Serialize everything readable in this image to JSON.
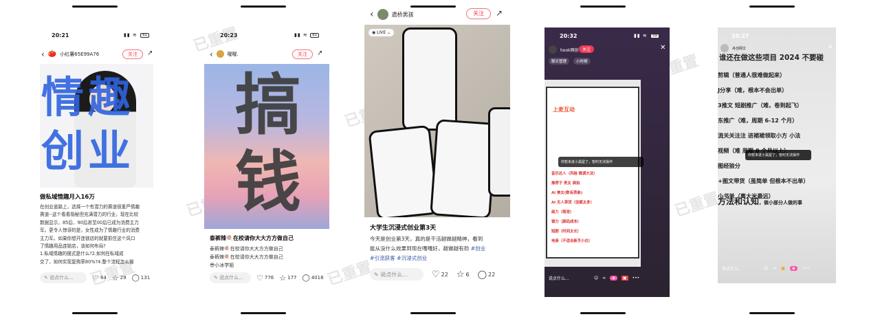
{
  "watermark": "已重置",
  "p1": {
    "time": "20:21",
    "battery": "61",
    "user": "小红薯65E99A76",
    "follow": "关注",
    "art_text": "情趣创业",
    "title": "做私域情趣月入16万",
    "lines": [
      "在创业道路上，选择一个有潜力的赛道很重严情趣",
      "赛道--这个看看隐秘但充满潜力的行业，现在比较",
      "数据显示，85后、90后甚至00后已成为消费主力",
      "军。更令人惊讶的是，女性成为了情趣行业的消费",
      "主力军。如果你想开连锁店的就要抓住这个风口",
      "了情趣用品连锁店，该如何布局?",
      "1.私域情趣的模式是什么?2.如何在私域成",
      "交了，如何实现复购率80%?4.整个流程怎么操"
    ],
    "input": "说点什么...",
    "likes": "44",
    "stars": "29",
    "comments": "131"
  },
  "p2": {
    "time": "20:23",
    "battery": "61",
    "user": "喔喔.",
    "follow": "关注",
    "art_text": "搞钱",
    "title": "泰裤辣🍭在校请你大大方方做自己",
    "lines": [
      "泰裤辣🍭在校请你大大方方做自己",
      "泰裤辣🍭在校请你大大方方做自己",
      "😎小冰学姐"
    ],
    "input": "说点什么...",
    "likes": "776",
    "stars": "177",
    "comments": "4018"
  },
  "p3": {
    "user": "遗桥男孩",
    "follow": "关注",
    "live": "LIVE",
    "title": "大学生沉浸式创业第3天",
    "line1": "今天是创业第3天，真的是干活越做越精神，看到",
    "line2": "能从没什么效果到现在嘎嘎好，越做越有劲",
    "tags": [
      "#创业",
      "#引流获客",
      "#沉浸式创业"
    ],
    "input": "说点什么...",
    "likes": "22",
    "stars": "6",
    "comments": "22"
  },
  "p4": {
    "time": "20:32",
    "battery": "59",
    "user": "hook网创",
    "follow": "关注",
    "tag1": "聊天管理",
    "tag2": "小时榜",
    "screen_title": "上麦互动",
    "toast": "你暂未进小黑屋了，暂时无法操作",
    "items": [
      "音乐达人（风格 微调大法）",
      "推荐子 男女 典拍",
      "AI 美女(数有表象)",
      "AI 无人带货（佳赋太多）",
      "画力（萌宠）",
      "钢力（颜码成本）",
      "短剧（时间太长）",
      "电商（不适合新手小白）"
    ],
    "input": "说点什么..."
  },
  "p5": {
    "time": "20:27",
    "user": "舟创网文",
    "headline": "谁还在做这些项目 2024 不要碰",
    "lines": [
      "剪辑（普通人很难做起来）",
      "J分享（难，根本不会出单）",
      "3推文 短剧推广（难，卷到起飞）",
      "东推广（难，周期 6-12 个月）",
      "流关关注注 进裙裙领取小方 小法",
      "视频（难 周期 8 个月以上）",
      "图经验分",
      "+图文带货（虽简单 但根本不出单）",
      "小书单（离大米最远）"
    ],
    "toast": "你暂未进小黑屋了，暂时无法操作",
    "footer_big": "方法和认知",
    "footer_small": "，做小部分人做的事",
    "input": "说点什么..."
  }
}
